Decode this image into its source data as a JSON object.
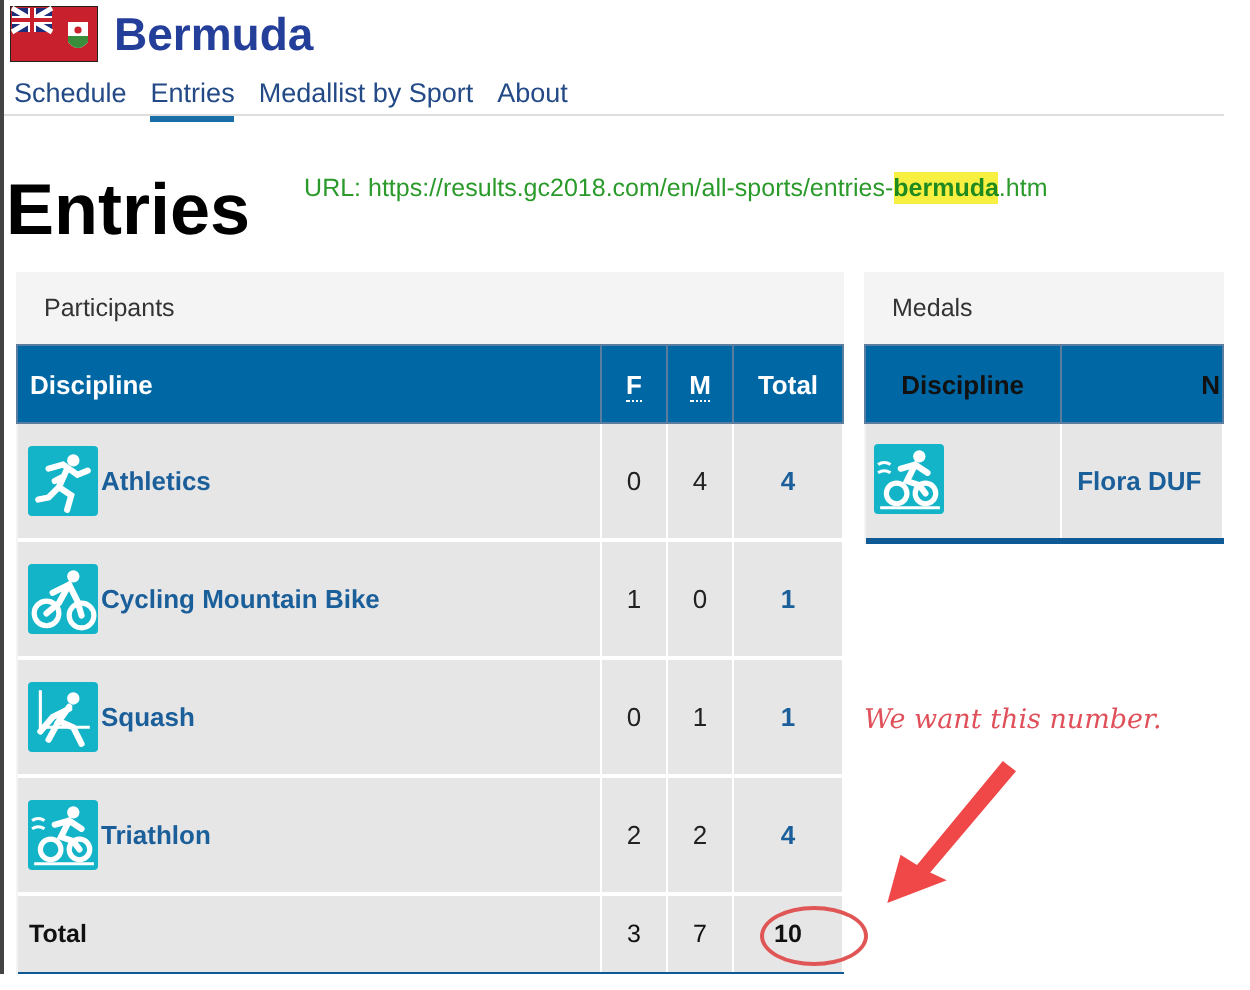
{
  "header": {
    "title": "Bermuda"
  },
  "nav": [
    {
      "label": "Schedule",
      "selected": false
    },
    {
      "label": "Entries",
      "selected": true
    },
    {
      "label": "Medallist by Sport",
      "selected": false
    },
    {
      "label": "About",
      "selected": false
    }
  ],
  "heading": "Entries",
  "url_note": "URL: https://results.gc2018.com/en/all-sports/entries-**bermuda**.htm",
  "participants": {
    "title": "Participants",
    "columns": [
      "Discipline",
      "F",
      "M",
      "Total"
    ],
    "rows": [
      {
        "kind": "athletics",
        "discipline": "Athletics",
        "f": "0",
        "m": "4",
        "total": "4"
      },
      {
        "kind": "cycling",
        "discipline": "Cycling Mountain Bike",
        "f": "1",
        "m": "0",
        "total": "1"
      },
      {
        "kind": "squash",
        "discipline": "Squash",
        "f": "0",
        "m": "1",
        "total": "1"
      },
      {
        "kind": "triathlon",
        "discipline": "Triathlon",
        "f": "2",
        "m": "2",
        "total": "4"
      }
    ],
    "total_row": {
      "label": "Total",
      "f": "3",
      "m": "7",
      "total": "10"
    }
  },
  "medals": {
    "title": "Medals",
    "columns": [
      "Discipline",
      "N"
    ],
    "rows": [
      {
        "kind": "triathlon",
        "name": "Flora DUF"
      }
    ]
  },
  "annotation": {
    "text": "We want this number."
  }
}
